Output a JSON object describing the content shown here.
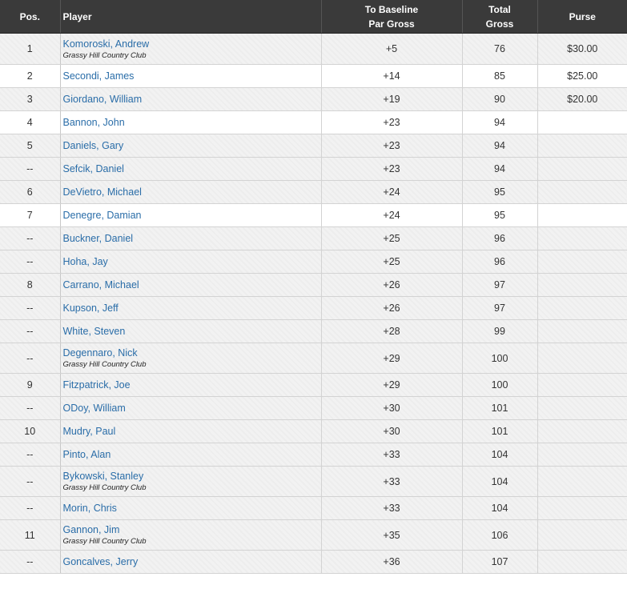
{
  "headers": {
    "pos": "Pos.",
    "player": "Player",
    "baseline_line1": "To Baseline",
    "baseline_line2": "Par Gross",
    "gross_line1": "Total",
    "gross_line2": "Gross",
    "purse": "Purse"
  },
  "rows": [
    {
      "pos": "1",
      "name": "Komoroski, Andrew",
      "club": "Grassy Hill Country Club",
      "par": "+5",
      "gross": "76",
      "purse": "$30.00"
    },
    {
      "pos": "2",
      "name": "Secondi, James",
      "club": "",
      "par": "+14",
      "gross": "85",
      "purse": "$25.00"
    },
    {
      "pos": "3",
      "name": "Giordano, William",
      "club": "",
      "par": "+19",
      "gross": "90",
      "purse": "$20.00"
    },
    {
      "pos": "4",
      "name": "Bannon, John",
      "club": "",
      "par": "+23",
      "gross": "94",
      "purse": ""
    },
    {
      "pos": "5",
      "name": "Daniels, Gary",
      "club": "",
      "par": "+23",
      "gross": "94",
      "purse": ""
    },
    {
      "pos": "--",
      "name": "Sefcik, Daniel",
      "club": "",
      "par": "+23",
      "gross": "94",
      "purse": ""
    },
    {
      "pos": "6",
      "name": "DeVietro, Michael",
      "club": "",
      "par": "+24",
      "gross": "95",
      "purse": ""
    },
    {
      "pos": "7",
      "name": "Denegre, Damian",
      "club": "",
      "par": "+24",
      "gross": "95",
      "purse": ""
    },
    {
      "pos": "--",
      "name": "Buckner, Daniel",
      "club": "",
      "par": "+25",
      "gross": "96",
      "purse": ""
    },
    {
      "pos": "--",
      "name": "Hoha, Jay",
      "club": "",
      "par": "+25",
      "gross": "96",
      "purse": ""
    },
    {
      "pos": "8",
      "name": "Carrano, Michael",
      "club": "",
      "par": "+26",
      "gross": "97",
      "purse": ""
    },
    {
      "pos": "--",
      "name": "Kupson, Jeff",
      "club": "",
      "par": "+26",
      "gross": "97",
      "purse": ""
    },
    {
      "pos": "--",
      "name": "White, Steven",
      "club": "",
      "par": "+28",
      "gross": "99",
      "purse": ""
    },
    {
      "pos": "--",
      "name": "Degennaro, Nick",
      "club": "Grassy Hill Country Club",
      "par": "+29",
      "gross": "100",
      "purse": ""
    },
    {
      "pos": "9",
      "name": "Fitzpatrick, Joe",
      "club": "",
      "par": "+29",
      "gross": "100",
      "purse": ""
    },
    {
      "pos": "--",
      "name": "ODoy, William",
      "club": "",
      "par": "+30",
      "gross": "101",
      "purse": ""
    },
    {
      "pos": "10",
      "name": "Mudry, Paul",
      "club": "",
      "par": "+30",
      "gross": "101",
      "purse": ""
    },
    {
      "pos": "--",
      "name": "Pinto, Alan",
      "club": "",
      "par": "+33",
      "gross": "104",
      "purse": ""
    },
    {
      "pos": "--",
      "name": "Bykowski, Stanley",
      "club": "Grassy Hill Country Club",
      "par": "+33",
      "gross": "104",
      "purse": ""
    },
    {
      "pos": "--",
      "name": "Morin, Chris",
      "club": "",
      "par": "+33",
      "gross": "104",
      "purse": ""
    },
    {
      "pos": "11",
      "name": "Gannon, Jim",
      "club": "Grassy Hill Country Club",
      "par": "+35",
      "gross": "106",
      "purse": ""
    },
    {
      "pos": "--",
      "name": "Goncalves, Jerry",
      "club": "",
      "par": "+36",
      "gross": "107",
      "purse": ""
    }
  ],
  "colors": {
    "header_bg": "#3a3a3a",
    "link": "#2a6da8",
    "row_shade": "#f2f2f2"
  }
}
